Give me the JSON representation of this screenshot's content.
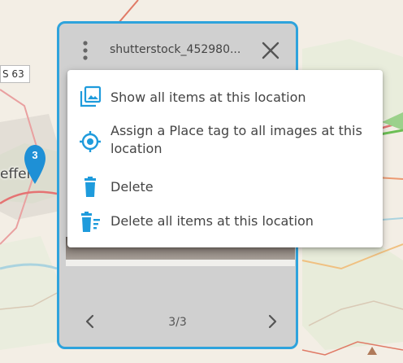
{
  "map": {
    "road_shield": "S 63",
    "town_label": "effer",
    "cluster_count": "3"
  },
  "panel": {
    "title": "shutterstock_452980...",
    "page_indicator": "3/3",
    "accent": "#2ea3dc"
  },
  "context_menu": {
    "items": [
      {
        "label": "Show all items at this location",
        "icon": "gallery-icon"
      },
      {
        "label": "Assign a Place tag to all images at this location",
        "icon": "target-icon"
      },
      {
        "label": "Delete",
        "icon": "trash-icon"
      },
      {
        "label": "Delete all items at this location",
        "icon": "trash-list-icon"
      }
    ],
    "icon_color": "#1e9bdc"
  }
}
